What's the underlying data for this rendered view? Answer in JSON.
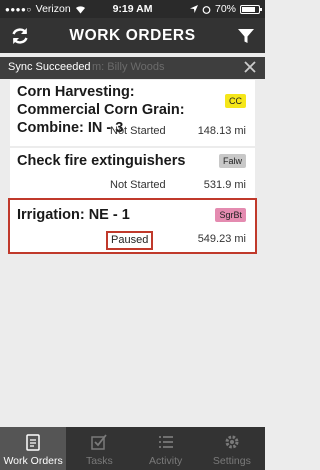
{
  "status_bar": {
    "carrier": "Verizon",
    "time": "9:19 AM",
    "battery": "70%"
  },
  "header": {
    "title": "WORK ORDERS"
  },
  "toast": {
    "message": "Sync Succeeded",
    "ghost_text": "m: Billy Woods"
  },
  "work_orders": [
    {
      "title": "Corn Harvesting: Commercial Corn Grain: Combine: IN - 3",
      "badge": "CC",
      "badge_color": "#f5e61a",
      "status": "Not Started",
      "distance": "148.13 mi"
    },
    {
      "title": "Check fire extinguishers",
      "badge": "Falw",
      "badge_color": "#c8c8c8",
      "status": "Not Started",
      "distance": "531.9 mi"
    },
    {
      "title": "Irrigation: NE - 1",
      "badge": "SgrBt",
      "badge_color": "#e48bb0",
      "status": "Paused",
      "distance": "549.23 mi"
    }
  ],
  "tabs": [
    {
      "label": "Work Orders",
      "icon": "clipboard-icon",
      "active": true
    },
    {
      "label": "Tasks",
      "icon": "checkbox-icon",
      "active": false
    },
    {
      "label": "Activity",
      "icon": "list-icon",
      "active": false
    },
    {
      "label": "Settings",
      "icon": "gear-icon",
      "active": false
    }
  ],
  "colors": {
    "header_bg": "#333333",
    "highlight": "#c0392b",
    "active_tab_bg": "#555555"
  }
}
